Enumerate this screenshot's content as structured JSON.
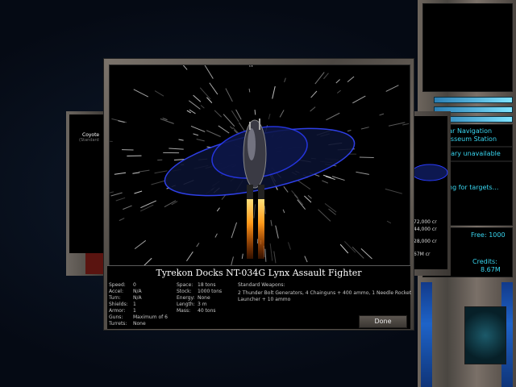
{
  "ship": {
    "title": "Tyrekon Docks NT-034G Lynx Assault Fighter",
    "stats_left": [
      {
        "label": "Speed:",
        "value": "0"
      },
      {
        "label": "Accel:",
        "value": "N/A"
      },
      {
        "label": "Turn:",
        "value": "N/A"
      },
      {
        "label": "Shields:",
        "value": "1"
      },
      {
        "label": "Armor:",
        "value": "1"
      },
      {
        "label": "Guns:",
        "value": "Maximum of 6"
      },
      {
        "label": "Turrets:",
        "value": "None"
      }
    ],
    "stats_right": [
      {
        "label": "Space:",
        "value": "18 tons"
      },
      {
        "label": "Stock:",
        "value": "1000 tons"
      },
      {
        "label": "Energy:",
        "value": "None"
      },
      {
        "label": "Length:",
        "value": "3 m"
      },
      {
        "label": "Mass:",
        "value": "40 tons"
      }
    ],
    "weapons_header": "Standard Weapons:",
    "weapons_line1": "2 Thunder Bolt Generators, 4 Chainguns + 400 ammo, 1 Needle Rocket",
    "weapons_line2": "Launcher + 10 ammo"
  },
  "buttons": {
    "done": "Done"
  },
  "left_panel": {
    "name": "Coyote",
    "sub": "(Standard"
  },
  "back_panel": {
    "prices": [
      "72,000 cr",
      "44,000 cr",
      "28,000 cr",
      "67M cr"
    ]
  },
  "hud": {
    "nav_line1": "lar Navigation",
    "nav_line2": "asseum Station",
    "secondary": "dary unavailable",
    "targets": "ng for targets...",
    "free": "Free: 1000",
    "credits_label": "Credits:",
    "credits_value": "8.67M"
  },
  "colors": {
    "hud_text": "#38d6f0",
    "engine_flame": "#ff9a1a",
    "hull_glow": "#2a3cff"
  }
}
